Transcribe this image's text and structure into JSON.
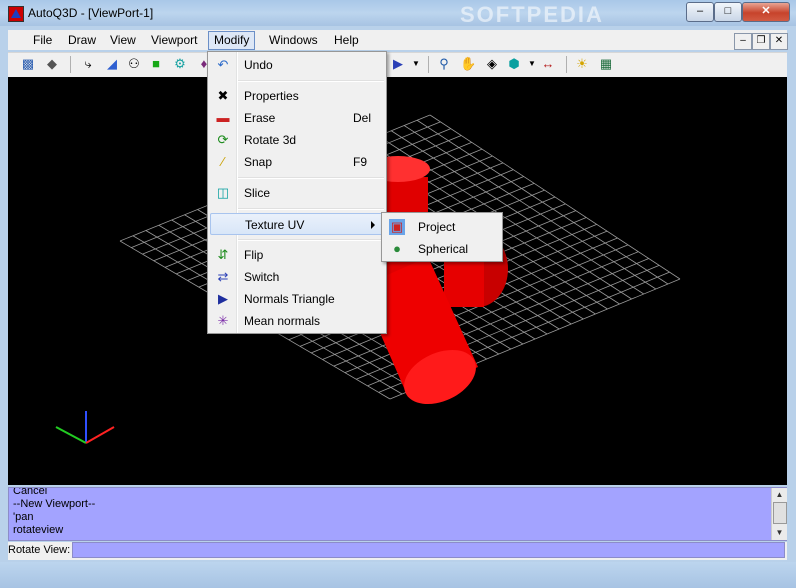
{
  "window": {
    "title": "AutoQ3D - [ViewPort-1]",
    "minimize": "–",
    "maximize": "□",
    "close": "✕",
    "watermark": "SOFTPEDIA"
  },
  "menubar": {
    "items": [
      "File",
      "Draw",
      "View",
      "Viewport",
      "Modify",
      "Windows",
      "Help"
    ],
    "active": "Modify",
    "mdi_minimize": "–",
    "mdi_restore": "❐",
    "mdi_close": "✕"
  },
  "modify_menu": {
    "items": [
      {
        "label": "Undo",
        "shortcut": "",
        "icon": "undo-icon"
      },
      {
        "label": "Properties",
        "shortcut": "",
        "icon": "tools-icon"
      },
      {
        "label": "Erase",
        "shortcut": "Del",
        "icon": "eraser-icon"
      },
      {
        "label": "Rotate 3d",
        "shortcut": "",
        "icon": "rotate-3d-icon"
      },
      {
        "label": "Snap",
        "shortcut": "F9",
        "icon": "snap-icon"
      },
      {
        "label": "Slice",
        "shortcut": "",
        "icon": "slice-icon"
      },
      {
        "label": "Texture UV",
        "shortcut": "",
        "icon": ""
      },
      {
        "label": "Flip",
        "shortcut": "",
        "icon": "flip-icon"
      },
      {
        "label": "Switch",
        "shortcut": "",
        "icon": "switch-icon"
      },
      {
        "label": "Normals Triangle",
        "shortcut": "",
        "icon": "normals-triangle-icon"
      },
      {
        "label": "Mean normals",
        "shortcut": "",
        "icon": "mean-normals-icon"
      }
    ]
  },
  "texture_submenu": {
    "items": [
      {
        "label": "Project",
        "icon": "project-texture-icon"
      },
      {
        "label": "Spherical",
        "icon": "globe-icon"
      }
    ]
  },
  "command_log": [
    "Cancel",
    "--New Viewport--",
    "'pan",
    "rotateview"
  ],
  "status": {
    "label": "Rotate View:",
    "value": ""
  },
  "colors": {
    "viewport": "#000000",
    "command_bg": "#a3a3ff",
    "cylinder": "#ff0000",
    "grid": "#9a9a9a"
  }
}
